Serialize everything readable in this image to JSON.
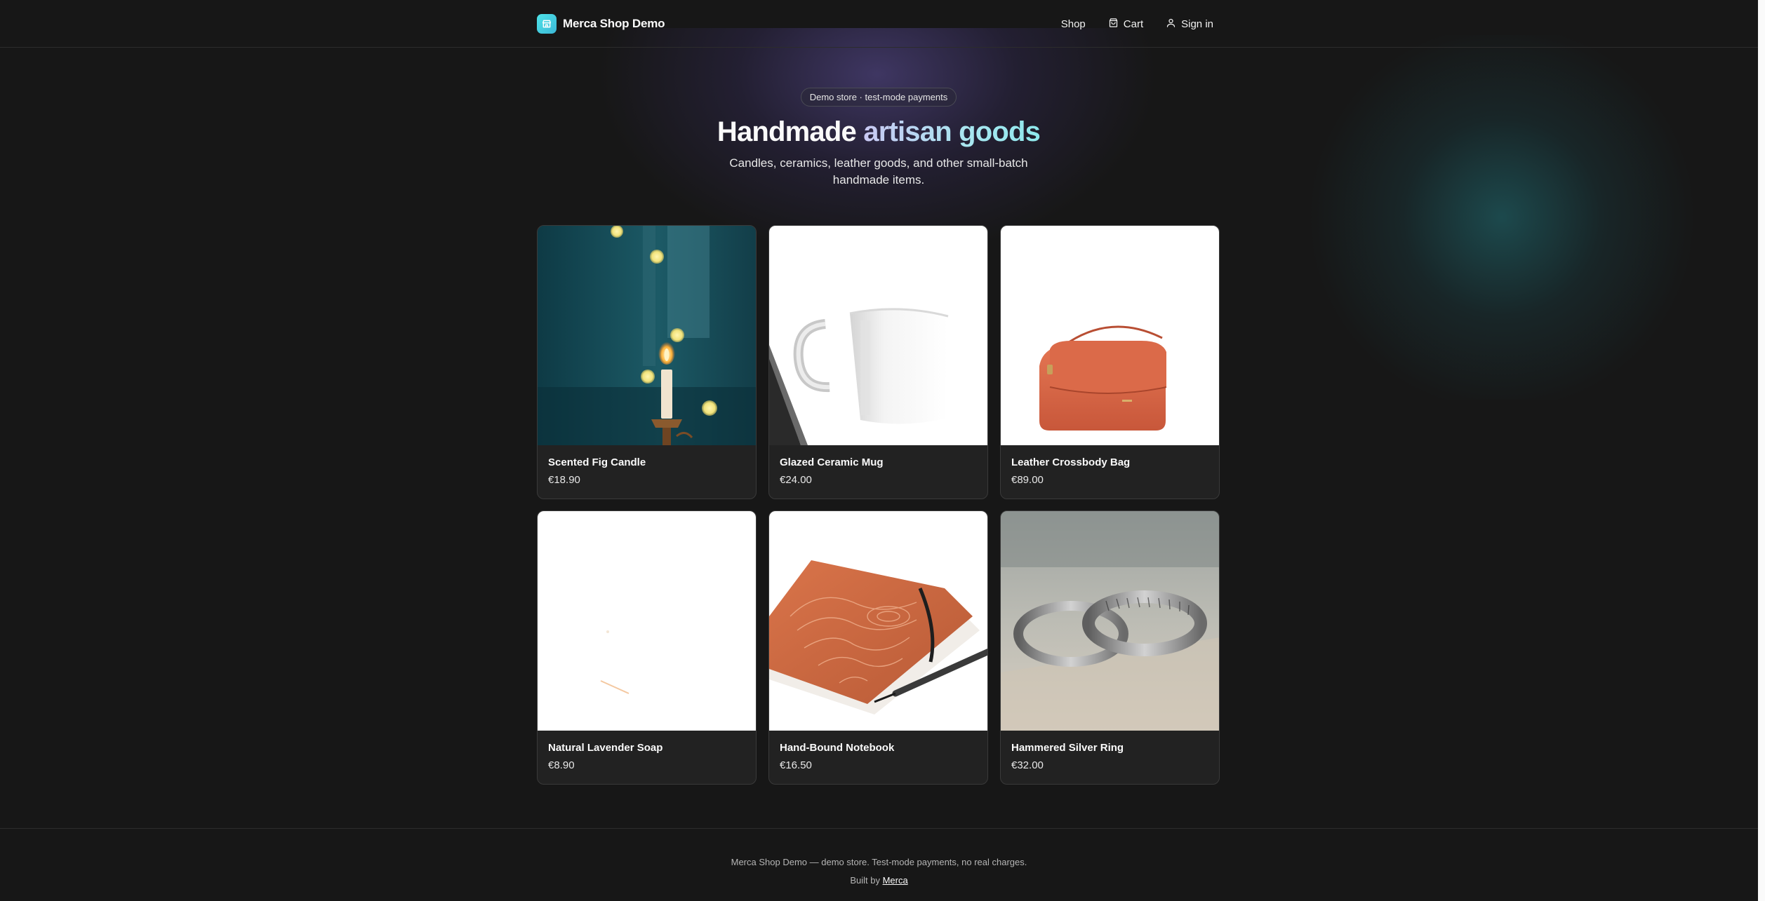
{
  "brand": {
    "name": "Merca Shop Demo",
    "logo_icon": "shop-icon",
    "logo_color": "#4ee3e8"
  },
  "nav": {
    "shop": "Shop",
    "cart": "Cart",
    "signin": "Sign in"
  },
  "hero": {
    "badge": "Demo store · test-mode payments",
    "title_plain": "Handmade ",
    "title_accent": "artisan goods",
    "subtitle": "Candles, ceramics, leather goods, and other small-batch handmade items."
  },
  "products": [
    {
      "name": "Scented Fig Candle",
      "price": "€18.90"
    },
    {
      "name": "Glazed Ceramic Mug",
      "price": "€24.00"
    },
    {
      "name": "Leather Crossbody Bag",
      "price": "€89.00"
    },
    {
      "name": "Natural Lavender Soap",
      "price": "€8.90"
    },
    {
      "name": "Hand-Bound Notebook",
      "price": "€16.50"
    },
    {
      "name": "Hammered Silver Ring",
      "price": "€32.00"
    }
  ],
  "footer": {
    "note": "Merca Shop Demo — demo store. Test-mode payments, no real charges.",
    "built_prefix": "Built by ",
    "built_link": "Merca"
  },
  "colors": {
    "background": "#171717",
    "accent": "#8ee8ec",
    "card": "#222222"
  }
}
